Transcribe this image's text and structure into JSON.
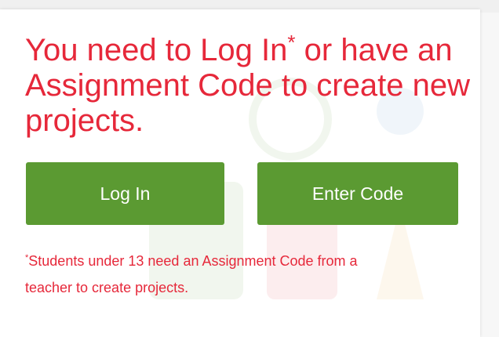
{
  "message": {
    "line1_prefix": "You need to Log In",
    "asterisk": "*",
    "line1_suffix": " or have an",
    "line2": "Assignment Code to create new",
    "line3": "projects."
  },
  "buttons": {
    "login_label": "Log In",
    "enter_code_label": "Enter Code"
  },
  "footnote": {
    "asterisk": "*",
    "line1": "Students under 13 need an Assignment Code from a",
    "line2": "teacher to create projects."
  },
  "colors": {
    "accent_text": "#e6283a",
    "button_bg": "#5b9a32",
    "button_text": "#ffffff"
  }
}
